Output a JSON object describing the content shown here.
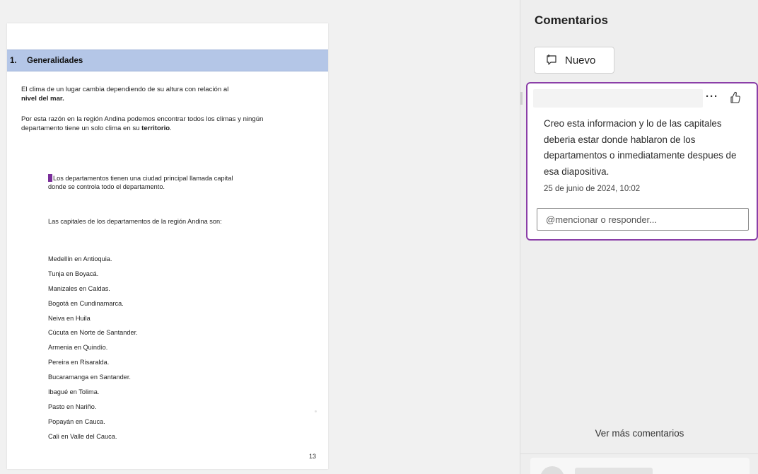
{
  "document": {
    "heading": {
      "number": "1.",
      "title": "Generalidades"
    },
    "paragraph1": {
      "text": "El clima de un lugar cambia dependiendo de su altura con relación al",
      "bold": "nivel del mar."
    },
    "paragraph2": {
      "text": "Por esta razón en la región Andina podemos encontrar todos los climas y ningún departamento tiene un solo clima en su",
      "bold": "territorio",
      "end": "."
    },
    "inner1": {
      "lead": "Lo",
      "rest": "s departamentos tienen una ciudad principal llamada capital donde se controla todo el departamento."
    },
    "inner2": "Las capitales de los departamentos de la región Andina son:",
    "capitals": [
      "Medellín en Antioquia.",
      "Tunja en Boyacá.",
      "Manizales en Caldas.",
      "Bogotá en Cundinamarca.",
      "Neiva en Huila",
      "Cúcuta en Norte de Santander.",
      "Armenia en Quindío.",
      "Pereira en Risaralda.",
      "Bucaramanga en Santander.",
      "Ibagué en Tolima.",
      "Pasto en Nariño.",
      "Popayán en Cauca.",
      "Cali en Valle del Cauca."
    ],
    "page_number": "13"
  },
  "comments_pane": {
    "title": "Comentarios",
    "new_button": "Nuevo",
    "comment": {
      "body": "Creo esta informacion y lo de las capitales deberia estar donde hablaron de los departamentos o inmediatamente despues de esa diapositiva.",
      "timestamp": "25 de junio de 2024, 10:02",
      "more_label": "···",
      "reply_placeholder": "@mencionar o responder..."
    },
    "see_more": "Ver más comentarios"
  },
  "colors": {
    "heading_fill": "#b4c6e7",
    "accent": "#8b3fa8",
    "pane_bg": "#eeeeee"
  },
  "icons": [
    "new-comment-icon",
    "more-options-icon",
    "like-icon"
  ]
}
